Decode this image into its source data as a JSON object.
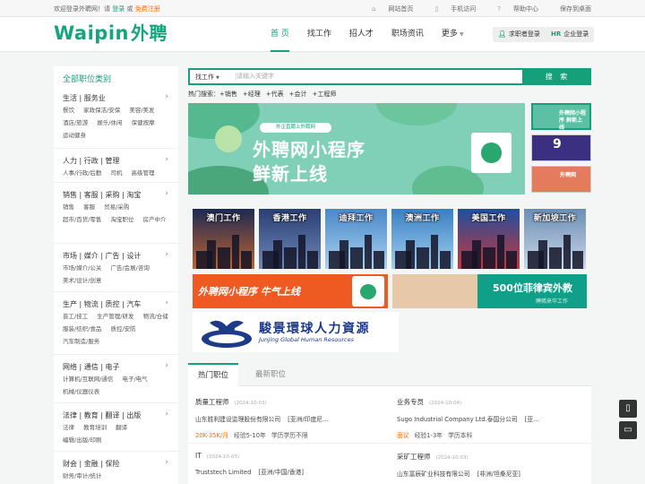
{
  "topbar": {
    "welcome_prefix": "欢迎登录外聘网！请",
    "login": "登录",
    "or": "或",
    "register": "免费注册",
    "links": [
      "网站首页",
      "手机访问",
      "帮助中心",
      "保存到桌面"
    ]
  },
  "header": {
    "logo_text": "Waipin",
    "logo_cn": "外聘",
    "nav": [
      "首 页",
      "找工作",
      "招人才",
      "职场资讯",
      "更多"
    ],
    "jobseeker_login": "求职者登录",
    "hr_tag": "HR",
    "company_login": "企业登录"
  },
  "sidebar": {
    "title": "全部职位类别",
    "categories": [
      {
        "name": "生活 | 服务业",
        "subs": [
          "餐饮",
          "家政保洁/安保",
          "美容/美发",
          "酒店/旅游",
          "娱乐/休闲",
          "保健按摩",
          "运动健身"
        ]
      },
      {
        "name": "人力 | 行政 | 管理",
        "subs": [
          "人事/行政/后勤",
          "司机",
          "高级管理"
        ]
      },
      {
        "name": "销售 | 客服 | 采购 | 淘宝",
        "subs": [
          "销售",
          "客服",
          "贸易/采购",
          "超市/百货/零售",
          "淘宝职位",
          "房产中介"
        ]
      },
      {
        "name": "市场 | 媒介 | 广告 | 设计",
        "subs": [
          "市场/媒介/公关",
          "广告/会展/咨询",
          "美术/设计/创意"
        ]
      },
      {
        "name": "生产 | 物流 | 质控 | 汽车",
        "subs": [
          "普工/技工",
          "生产管理/研发",
          "物流/仓储",
          "服装/纺织/食品",
          "质控/安防",
          "汽车制造/服务"
        ]
      },
      {
        "name": "网络 | 通信 | 电子",
        "subs": [
          "计算机/互联网/通信",
          "电子/电气",
          "机械/仪器仪表"
        ]
      },
      {
        "name": "法律 | 教育 | 翻译 | 出版",
        "subs": [
          "法律",
          "教育培训",
          "翻译",
          "编辑/出版/印刷"
        ]
      },
      {
        "name": "财会 | 金融 | 保险",
        "subs": [
          "财务/审计/统计"
        ]
      }
    ]
  },
  "search": {
    "type": "找工作",
    "placeholder": "请输入关键字",
    "button": "搜 索",
    "hot_label": "热门搜索：",
    "hot": [
      "+销售",
      "+经理",
      "+代表",
      "+会计",
      "+工程师"
    ]
  },
  "banner": {
    "tag": "外企直聘上外聘网",
    "line1": "外聘网小程序",
    "line2": "鲜新上线"
  },
  "thumbs": [
    "外聘网小程序 鲜新上线",
    "9",
    "外聘网"
  ],
  "cities": [
    "澳门工作",
    "香港工作",
    "迪拜工作",
    "澳洲工作",
    "美国工作",
    "新加坡工作"
  ],
  "promos": {
    "left": "外聘网小程序 牛气上线",
    "right_title": "500位菲律宾外教",
    "right_sub": "聘稀来华工作"
  },
  "partner": {
    "cn": "駿景環球人力資源",
    "en": "Junjing Global Human Resources"
  },
  "tabs": [
    "热门职位",
    "最新职位"
  ],
  "jobs": [
    {
      "title": "质量工程师",
      "date": "(2024-10-03)",
      "company": "山东胜利建设监理股份有限公司",
      "location": "[亚洲/印度尼…",
      "salary": "20K-35K/月",
      "exp": "经验5-10年",
      "edu": "学历学历不限"
    },
    {
      "title": "业务专员",
      "date": "(2024-10-04)",
      "company": "Sugo Industrial Company Ltd.泰国分公司",
      "location": "[亚…",
      "salary": "面议",
      "exp": "经验1-3年",
      "edu": "学历本科"
    },
    {
      "title": "IT",
      "date": "(2024-10-03)",
      "company": "Truststech Limited",
      "location": "[亚洲/中国/香港]"
    },
    {
      "title": "采矿工程师",
      "date": "(2024-10-03)",
      "company": "山东富辰矿业科技有限公司",
      "location": "[非洲/坦桑尼亚]"
    }
  ],
  "float_buttons": [
    "phone-icon",
    "chat-icon"
  ],
  "colors": {
    "brand": "#13a07a",
    "accent": "#ff6a00"
  }
}
